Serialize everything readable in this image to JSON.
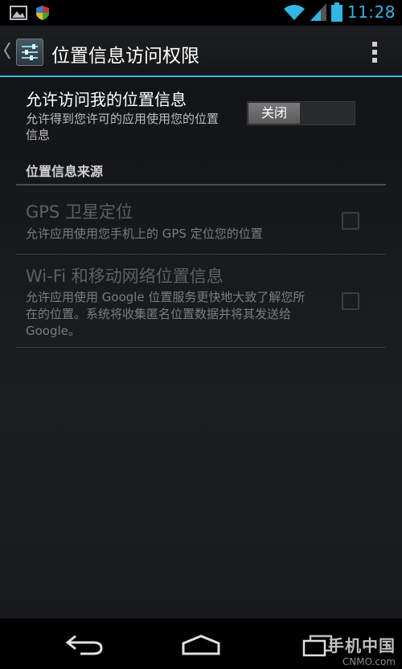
{
  "status_bar": {
    "time": "11:28",
    "left_icons": [
      "gallery-icon",
      "shield-icon"
    ],
    "right_icons": [
      "wifi-icon",
      "signal-icon",
      "battery-icon"
    ],
    "accent_color": "#33b5e5"
  },
  "action_bar": {
    "title": "位置信息访问权限",
    "app_icon": "settings-sliders-icon",
    "overflow_icon": "overflow-menu-icon"
  },
  "master_switch": {
    "title": "允许访问我的位置信息",
    "summary": "允许得到您许可的应用使用您的位置信息",
    "switch_label": "关闭",
    "state": "off"
  },
  "category": {
    "title": "位置信息来源"
  },
  "preferences": [
    {
      "title": "GPS 卫星定位",
      "summary": "允许应用使用您手机上的 GPS 定位您的位置",
      "checked": false,
      "enabled": false
    },
    {
      "title": "Wi-Fi 和移动网络位置信息",
      "summary": "允许应用使用 Google 位置服务更快地大致了解您所在的位置。系统将收集匿名位置数据并将其发送给 Google。",
      "checked": false,
      "enabled": false
    }
  ],
  "nav_bar": {
    "icons": [
      "back-icon",
      "home-icon",
      "recents-icon"
    ]
  },
  "watermark": {
    "logo": "手机中国",
    "sub": "CNMO.com"
  }
}
